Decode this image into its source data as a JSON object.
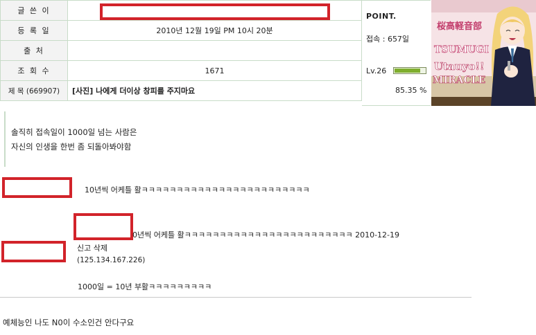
{
  "info": {
    "writer_label": "글 쓴 이",
    "date_label": "등 록 일",
    "date_value": "2010년 12월 19일 PM 10시 20분",
    "source_label": "출 처",
    "source_value": "",
    "views_label": "조 회 수",
    "views_value": "1671",
    "subject_label": "제 목 (669907)",
    "subject_value": "[사진] 나에게 더이상 창피를 주지마요"
  },
  "point": {
    "title": "POINT.",
    "visits": "접속 : 657일",
    "level": "Lv.26",
    "percent": "85.35 %",
    "progress": 0.8535
  },
  "avatar": {
    "sign_text": "桜高軽音部",
    "name_text": "TSUMUGI",
    "song_text_1": "Utauyo!!",
    "song_text_2": "MIRACLE",
    "colors": {
      "bg": "#f4d9de",
      "hair": "#f3d37a",
      "uniform": "#1f2340",
      "skin": "#fbe6d6"
    }
  },
  "post": {
    "line1": "솔직히 접속일이 1000일 넘는 사람은",
    "line2": "자신의 인생을 한번 좀 되돌아봐야함"
  },
  "comments": {
    "c1": "10년씩 어케틀 활ㅋㅋㅋㅋㅋㅋㅋㅋㅋㅋㅋㅋㅋㅋㅋㅋㅋㅋㅋㅋㅋㅋㅋㅋ",
    "c2": "0년씩 어케틀 활ㅋㅋㅋㅋㅋㅋㅋㅋㅋㅋㅋㅋㅋㅋㅋㅋㅋㅋㅋㅋㅋㅋㅋㅋ 2010-12-19",
    "report": "신고",
    "delete": "삭제",
    "ip": "(125.134.167.226)",
    "c3": "1000일 = 10년 부활ㅋㅋㅋㅋㅋㅋㅋㅋㅋ",
    "c4": "예체능인 나도 N0이 수소인건 안다구요"
  },
  "colors": {
    "redact": "#d2232a",
    "border": "#c8dcc8"
  }
}
